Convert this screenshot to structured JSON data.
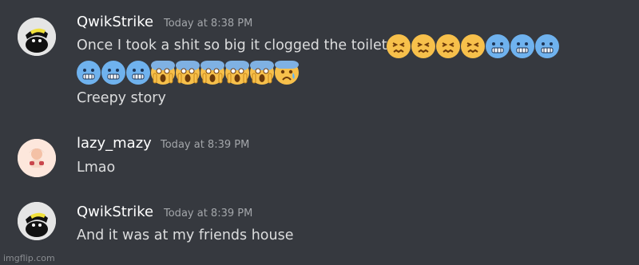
{
  "messages": [
    {
      "username": "QwikStrike",
      "timestamp": "Today at 8:38 PM",
      "lines": [
        "Once I took a shit so big it clogged the toilet",
        "Creepy story"
      ],
      "emoji_row1": [
        "confounded",
        "confounded",
        "confounded",
        "confounded",
        "cold-face",
        "cold-face",
        "cold-face"
      ],
      "emoji_row2": [
        "cold-face",
        "cold-face",
        "cold-face",
        "scream",
        "scream",
        "scream",
        "scream",
        "scream",
        "fearful"
      ]
    },
    {
      "username": "lazy_mazy",
      "timestamp": "Today at 8:39 PM",
      "lines": [
        "Lmao"
      ]
    },
    {
      "username": "QwikStrike",
      "timestamp": "Today at 8:39 PM",
      "lines": [
        "And it was at my friends house"
      ]
    }
  ],
  "watermark": "imgflip.com"
}
